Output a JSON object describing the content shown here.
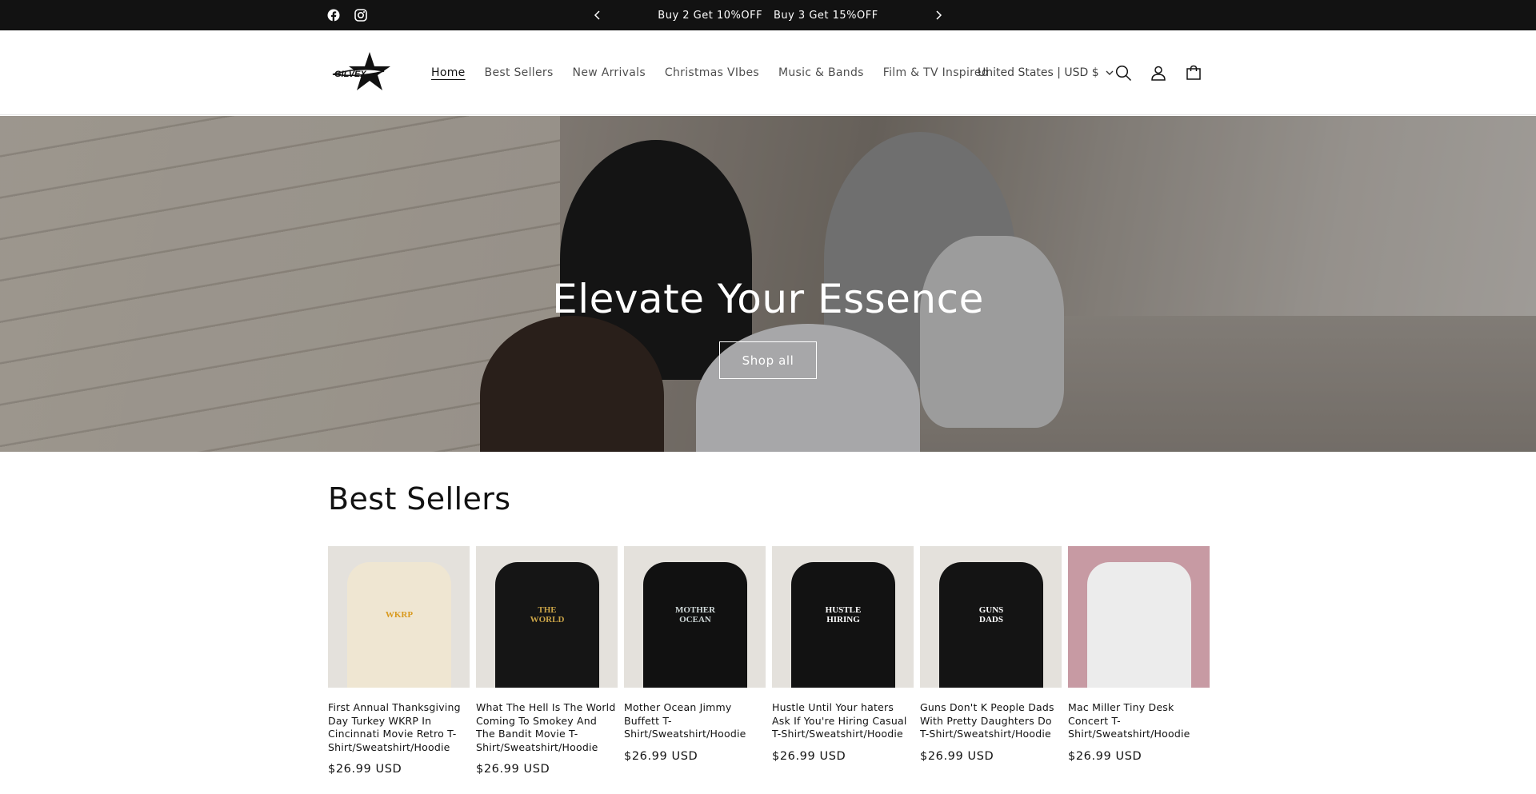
{
  "announcement": {
    "social": [
      "facebook-icon",
      "instagram-icon"
    ],
    "message": "Buy 2 Get 10%OFF   Buy 3 Get 15%OFF",
    "prev_icon": "chevron-left-icon",
    "next_icon": "chevron-right-icon"
  },
  "header": {
    "logo_text": "GILVEX",
    "nav": [
      {
        "label": "Home",
        "active": true
      },
      {
        "label": "Best Sellers"
      },
      {
        "label": "New Arrivals"
      },
      {
        "label": "Christmas VIbes"
      },
      {
        "label": "Music & Bands"
      },
      {
        "label": "Film & TV Inspired"
      }
    ],
    "country": "United States | USD $",
    "icons": [
      "search-icon",
      "account-icon",
      "cart-icon"
    ]
  },
  "hero": {
    "heading": "Elevate Your Essence",
    "button": "Shop all"
  },
  "best_sellers": {
    "heading": "Best Sellers",
    "products": [
      {
        "title": "First Annual Thanksgiving Day Turkey WKRP In Cincinnati Movie Retro T-Shirt/Sweatshirt/Hoodie",
        "price": "$26.99 USD",
        "color": "#efe6d2",
        "print": "WKRP",
        "print_color": "#d99a1e"
      },
      {
        "title": "What The Hell Is The World Coming To Smokey And The Bandit Movie T-Shirt/Sweatshirt/Hoodie",
        "price": "$26.99 USD",
        "color": "#151515",
        "print": "THE WORLD",
        "print_color": "#c9a347"
      },
      {
        "title": "Mother Ocean Jimmy Buffett T-Shirt/Sweatshirt/Hoodie",
        "price": "$26.99 USD",
        "color": "#111111",
        "print": "MOTHER OCEAN",
        "print_color": "#cfd8d8"
      },
      {
        "title": "Hustle Until Your haters Ask If You're Hiring Casual T-Shirt/Sweatshirt/Hoodie",
        "price": "$26.99 USD",
        "color": "#121212",
        "print": "HUSTLE HIRING",
        "print_color": "#ffffff"
      },
      {
        "title": "Guns Don't K People Dads With Pretty Daughters Do T-Shirt/Sweatshirt/Hoodie",
        "price": "$26.99 USD",
        "color": "#141414",
        "print": "GUNS DADS",
        "print_color": "#ffffff"
      },
      {
        "title": "Mac Miller Tiny Desk Concert T-Shirt/Sweatshirt/Hoodie",
        "price": "$26.99 USD",
        "color": "#ececec",
        "print": "",
        "print_color": "#333333",
        "bg": "#c79aa3"
      }
    ]
  }
}
